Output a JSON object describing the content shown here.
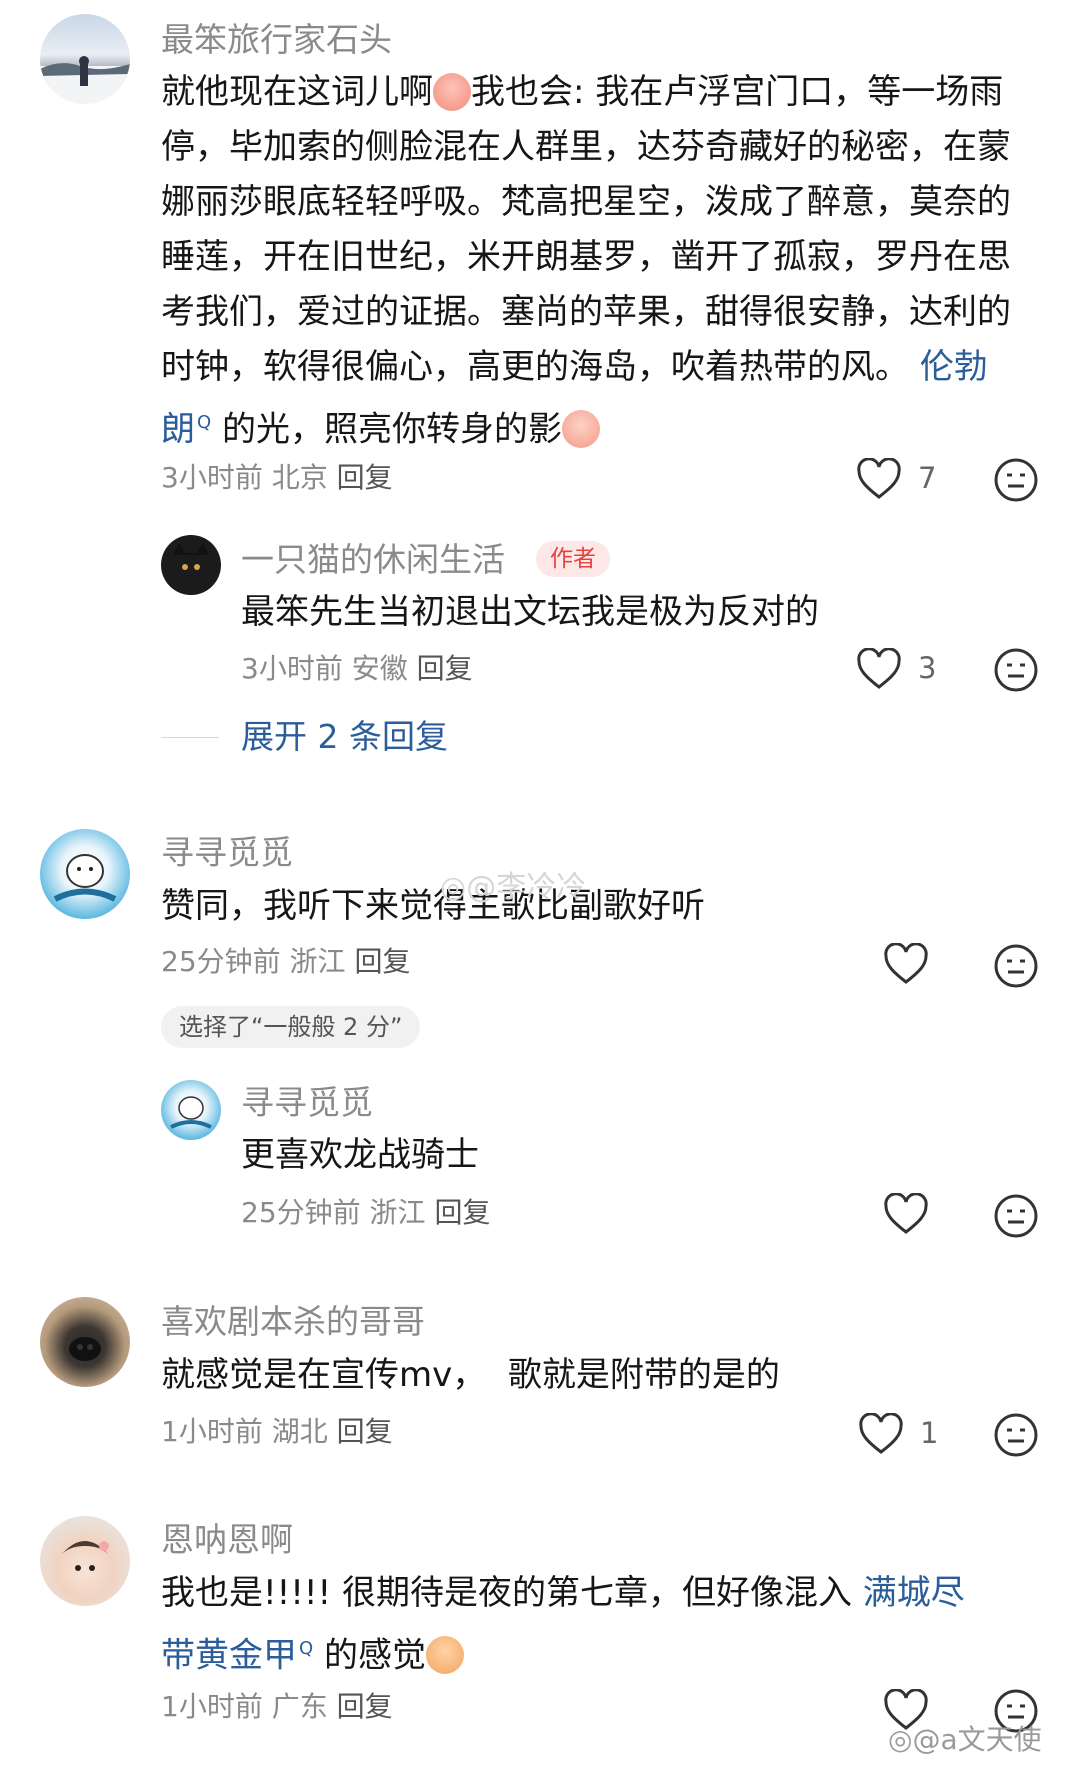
{
  "comments": [
    {
      "username": "最笨旅行家石头",
      "lines": [
        {
          "a": "就他现在这词儿啊",
          "b": "我也会: 我在卢浮宫门口，等一场雨"
        },
        {
          "a": "停，毕加索的侧脸混在人群里，达芬奇藏好的秘密，在蒙"
        },
        {
          "a": "娜丽莎眼底轻轻呼吸。梵高把星空，泼成了醉意，莫奈的"
        },
        {
          "a": "睡莲，开在旧世纪，米开朗基罗，凿开了孤寂，罗丹在思"
        },
        {
          "a": "考我们，爱过的证据。塞尚的苹果，甜得很安静，达利的"
        },
        {
          "a": "时钟，软得很偏心，高更的海岛，吹着热带的风。",
          "link": "伦勃"
        },
        {
          "link": "朗",
          "b": " 的光，照亮你转身的影"
        }
      ],
      "meta": "3小时前 北京",
      "reply": "回复",
      "likes": "7",
      "replies": [
        {
          "username": "一只猫的休闲生活",
          "badge": "作者",
          "text": "最笨先生当初退出文坛我是极为反对的",
          "meta": "3小时前 安徽",
          "reply": "回复",
          "likes": "3"
        }
      ],
      "expand": "展开 2 条回复"
    },
    {
      "username": "寻寻觅觅",
      "text": "赞同，我听下来觉得主歌比副歌好听",
      "meta": "25分钟前 浙江",
      "reply": "回复",
      "likes": "",
      "chip": "选择了“一般般 2 分”",
      "replies": [
        {
          "username": "寻寻觅觅",
          "text": "更喜欢龙战骑士",
          "meta": "25分钟前 浙江",
          "reply": "回复",
          "likes": ""
        }
      ]
    },
    {
      "username": "喜欢剧本杀的哥哥",
      "text": "就感觉是在宣传mv，  歌就是附带的是的",
      "meta": "1小时前 湖北",
      "reply": "回复",
      "likes": "1"
    },
    {
      "username": "恩呐恩啊",
      "line1": "我也是!!!!!  很期待是夜的第七章，但好像混入 ",
      "line1_link": "满城尽",
      "line2_link": "带黄金甲",
      "line2_b": " 的感觉",
      "meta": "1小时前 广东",
      "reply": "回复",
      "likes": ""
    }
  ],
  "watermarks": {
    "middle": "@李冷冷",
    "bottom": "@a文天使"
  },
  "colors": {
    "link": "#2b5d9b",
    "badge_bg": "#fde7e7",
    "badge_text": "#e2453c"
  }
}
